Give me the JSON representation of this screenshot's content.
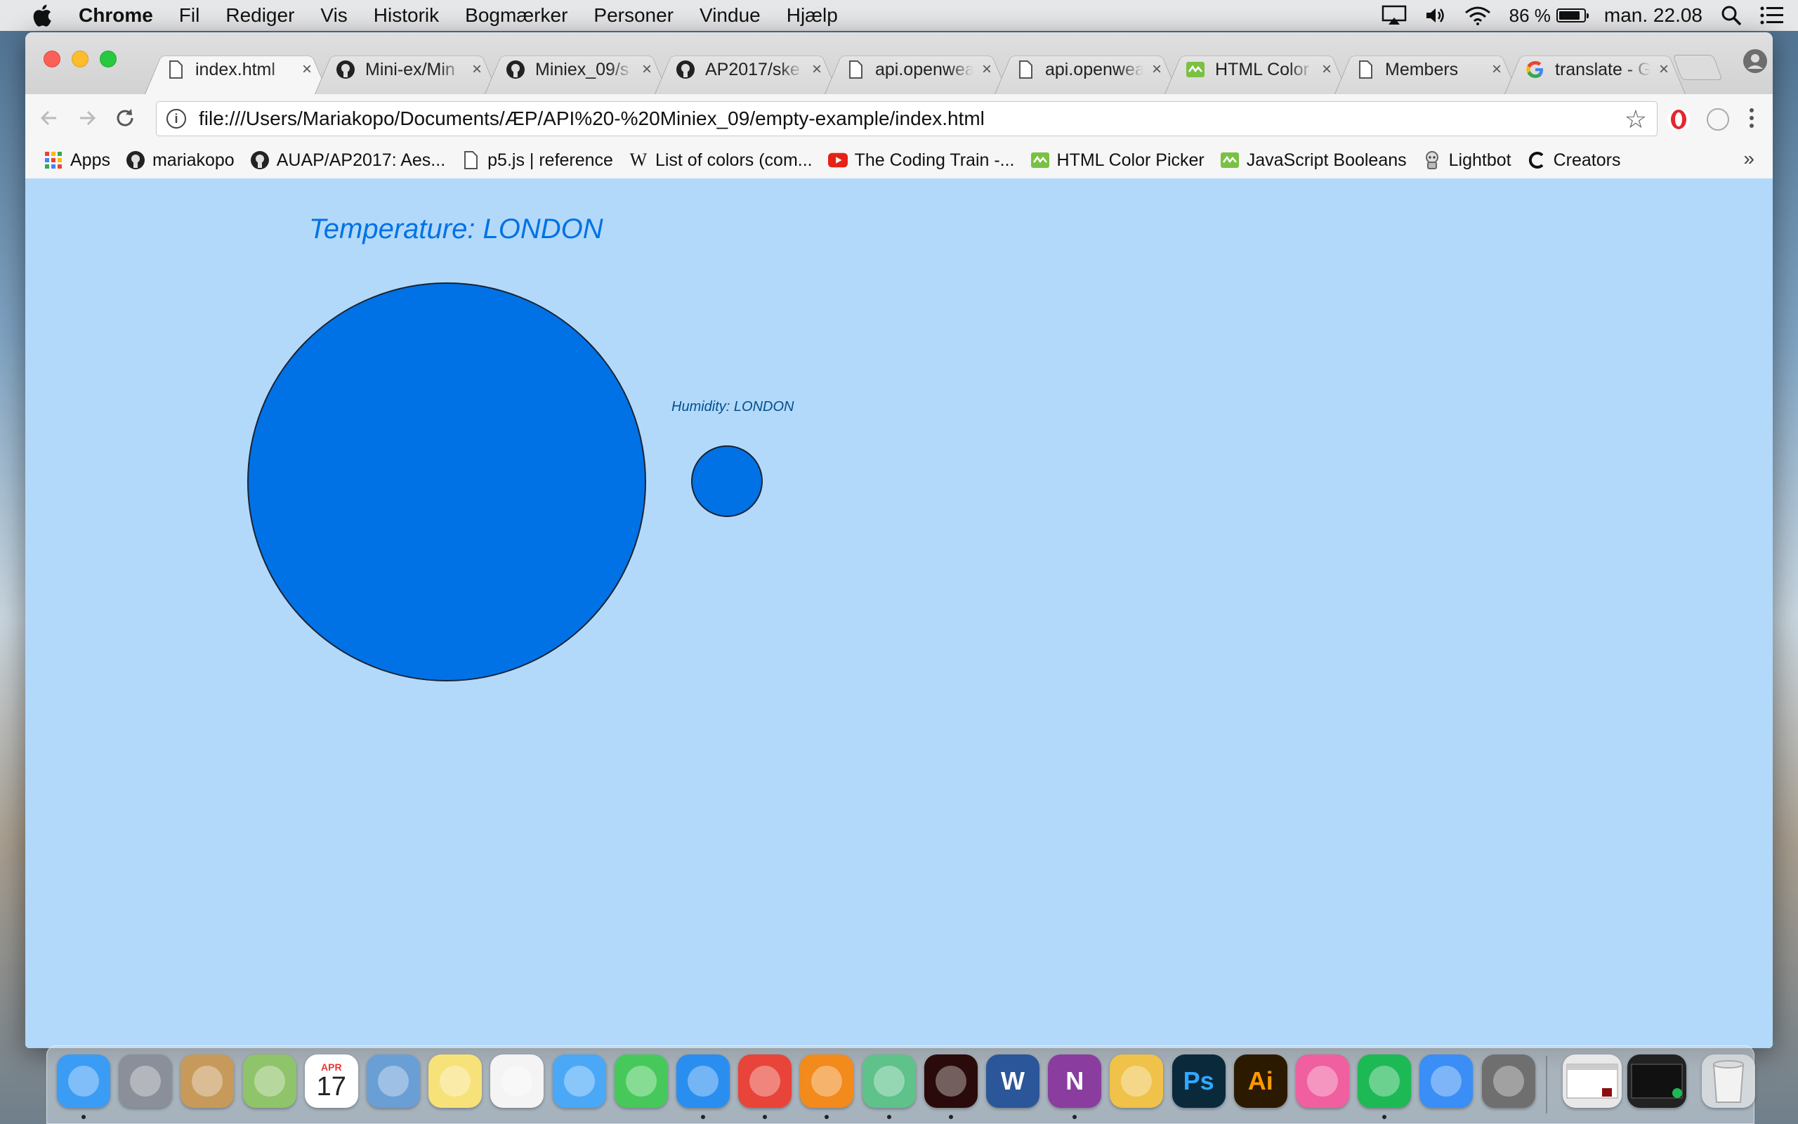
{
  "menubar": {
    "app_name": "Chrome",
    "menus": [
      "Fil",
      "Rediger",
      "Vis",
      "Historik",
      "Bogmærker",
      "Personer",
      "Vindue",
      "Hjælp"
    ],
    "battery_percent": "86 %",
    "battery_level": 0.86,
    "clock": "man. 22.08"
  },
  "tabs": [
    {
      "title": "index.html",
      "icon": "page-icon",
      "active": true
    },
    {
      "title": "Mini-ex/Min",
      "icon": "github-icon",
      "active": false
    },
    {
      "title": "Miniex_09/s",
      "icon": "github-icon",
      "active": false
    },
    {
      "title": "AP2017/ske",
      "icon": "github-icon",
      "active": false
    },
    {
      "title": "api.openwea",
      "icon": "page-icon",
      "active": false
    },
    {
      "title": "api.openwea",
      "icon": "page-icon",
      "active": false
    },
    {
      "title": "HTML Color",
      "icon": "colorpicker-icon",
      "active": false
    },
    {
      "title": "Members",
      "icon": "page-icon",
      "active": false
    },
    {
      "title": "translate - G",
      "icon": "google-icon",
      "active": false
    }
  ],
  "toolbar": {
    "url": "file:///Users/Mariakopo/Documents/ÆP/API%20-%20Miniex_09/empty-example/index.html"
  },
  "bookmarks": [
    {
      "label": "Apps",
      "icon": "apps-grid-icon"
    },
    {
      "label": "mariakopo",
      "icon": "github-icon"
    },
    {
      "label": "AUAP/AP2017: Aes...",
      "icon": "github-icon"
    },
    {
      "label": "p5.js | reference",
      "icon": "page-icon"
    },
    {
      "label": "List of colors (com...",
      "icon": "wikipedia-icon"
    },
    {
      "label": "The Coding Train -...",
      "icon": "youtube-icon"
    },
    {
      "label": "HTML Color Picker",
      "icon": "colorpicker-icon"
    },
    {
      "label": "JavaScript Booleans",
      "icon": "colorpicker-icon"
    },
    {
      "label": "Lightbot",
      "icon": "robot-icon"
    },
    {
      "label": "Creators",
      "icon": "creators-icon"
    }
  ],
  "page": {
    "temperature_label": "Temperature: LONDON",
    "humidity_label": "Humidity: LONDON",
    "background_color": "#b3d9fa",
    "circle_color": "#0072e5"
  },
  "dock": {
    "apps": [
      {
        "name": "finder-icon",
        "color": "#3b9cf5",
        "running": true
      },
      {
        "name": "launchpad-icon",
        "color": "#8a8f99",
        "running": false
      },
      {
        "name": "contacts-icon",
        "color": "#c79a5b",
        "running": false
      },
      {
        "name": "maps-icon",
        "color": "#8fc46a",
        "running": false
      },
      {
        "name": "calendar-icon",
        "color": "#ffffff",
        "running": false
      },
      {
        "name": "mail-icon",
        "color": "#6a9fd6",
        "running": false
      },
      {
        "name": "notes-icon",
        "color": "#f7e27a",
        "running": false
      },
      {
        "name": "reminders-icon",
        "color": "#f4f4f4",
        "running": false
      },
      {
        "name": "messages-icon",
        "color": "#4aa8f7",
        "running": false
      },
      {
        "name": "facetime-icon",
        "color": "#46c95a",
        "running": false
      },
      {
        "name": "safari-icon",
        "color": "#2a8ef0",
        "running": true
      },
      {
        "name": "chrome-icon",
        "color": "#e9443a",
        "running": true
      },
      {
        "name": "firefox-icon",
        "color": "#f28a1c",
        "running": true
      },
      {
        "name": "atom-icon",
        "color": "#5ec28a",
        "running": true
      },
      {
        "name": "acrobat-icon",
        "color": "#2a0a0a",
        "running": true
      },
      {
        "name": "word-icon",
        "color": "#2b5699",
        "running": false
      },
      {
        "name": "onenote-icon",
        "color": "#8a3d9e",
        "running": true
      },
      {
        "name": "photos-icon",
        "color": "#f0c24a",
        "running": false
      },
      {
        "name": "photoshop-icon",
        "color": "#0a2a3c",
        "running": false
      },
      {
        "name": "illustrator-icon",
        "color": "#2c1a00",
        "running": false
      },
      {
        "name": "itunes-icon",
        "color": "#f05fa0",
        "running": false
      },
      {
        "name": "spotify-icon",
        "color": "#1db954",
        "running": true
      },
      {
        "name": "appstore-icon",
        "color": "#3a8ef5",
        "running": false
      },
      {
        "name": "system-preferences-icon",
        "color": "#6f6f6f",
        "running": false
      }
    ],
    "calendar_month": "APR",
    "calendar_day": "17",
    "word_letter": "W",
    "onenote_letter": "N",
    "photoshop_letter": "Ps",
    "illustrator_letter": "Ai"
  }
}
